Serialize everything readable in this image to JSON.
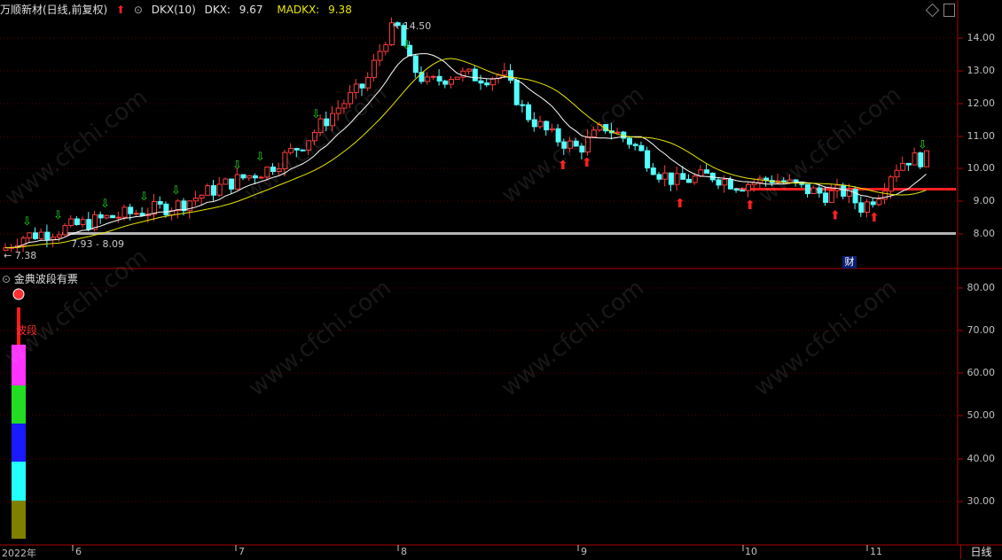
{
  "header": {
    "stock_name": "万顺新材(日线,前复权)",
    "indicator_name": "DKX(10)",
    "dkx_label": "DKX:",
    "dkx_value": "9.67",
    "madkx_label": "MADKX:",
    "madkx_value": "9.38"
  },
  "sub_header": {
    "indicator_name": "金典波段有票",
    "band_label": "波段"
  },
  "price_axis": [
    "14.00",
    "13.00",
    "12.00",
    "11.00",
    "10.00",
    "9.00",
    "8.00"
  ],
  "sub_axis": [
    "80.00",
    "70.00",
    "60.00",
    "50.00",
    "40.00",
    "30.00"
  ],
  "annotations": {
    "high_price": "14.50",
    "low_price": "7.38",
    "range": "7.93 - 8.09",
    "event_tag": "财"
  },
  "time_axis": [
    "2022年",
    "6",
    "7",
    "8",
    "9",
    "10",
    "11"
  ],
  "period_button": "日线",
  "watermark": "www.cfchi.com",
  "colors": {
    "up": "#ff3b3b",
    "down": "#54ffff",
    "dkx": "#ffffff",
    "madkx": "#e6e600",
    "frame": "#b00000"
  },
  "band_colors": [
    "#ff1a1a",
    "#ff33ff",
    "#22dd22",
    "#1a1aff",
    "#22ffff",
    "#808000"
  ]
}
